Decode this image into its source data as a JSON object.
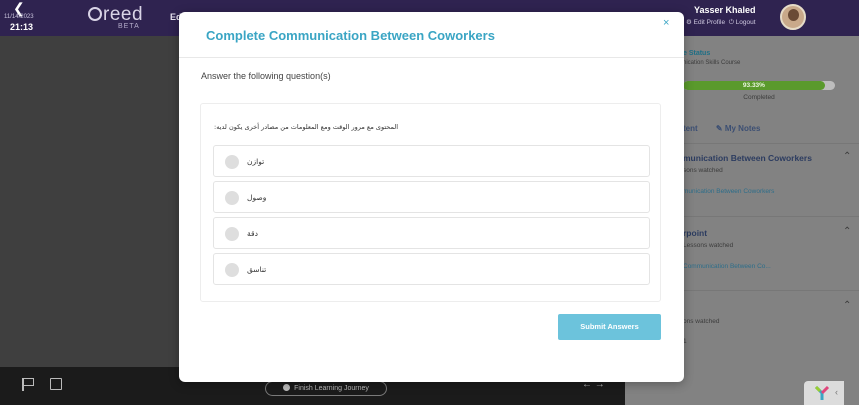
{
  "header": {
    "back_icon": "chevron-left-icon",
    "date": "11/14/2023",
    "time": "21:13",
    "logo": "reed",
    "badge": "BETA",
    "nav_partial": "Ed",
    "user_name": "Yasser Khaled",
    "edit_profile": "⚙ Edit Profile",
    "logout": "⏻ Logout"
  },
  "sidebar": {
    "status_title": "e Status",
    "course_name": "nication Skills Course",
    "progress_percent": 93.33,
    "progress_label": "93.33%",
    "completed_label": "Completed",
    "tab_content": "tent",
    "tab_notes": "My Notes",
    "sections": [
      {
        "title": "munication Between Coworkers",
        "sub": "sons watched",
        "link": "munication Between Coworkers"
      },
      {
        "title": "rpoint",
        "sub": "Lessons watched",
        "link": "Communication Between Co..."
      },
      {
        "title": "",
        "sub": "ons watched",
        "link": "1"
      }
    ]
  },
  "bottom": {
    "finish_label": "Finish Learning Journey",
    "arrows": "← →"
  },
  "modal": {
    "title": "Complete Communication Between Coworkers",
    "close": "×",
    "instruction": "Answer the following question(s)",
    "question": "المحتوى مع مرور الوقت ومع المعلومات من مصادر أخرى يكون لديه:",
    "options": [
      "توازن",
      "وصول",
      "دقة",
      "تناسق"
    ],
    "submit_label": "Submit Answers"
  },
  "colors": {
    "accent": "#3aa5c4",
    "submit": "#6cc3dc",
    "topbar": "#2f2350",
    "progress": "#5a9a2c"
  }
}
